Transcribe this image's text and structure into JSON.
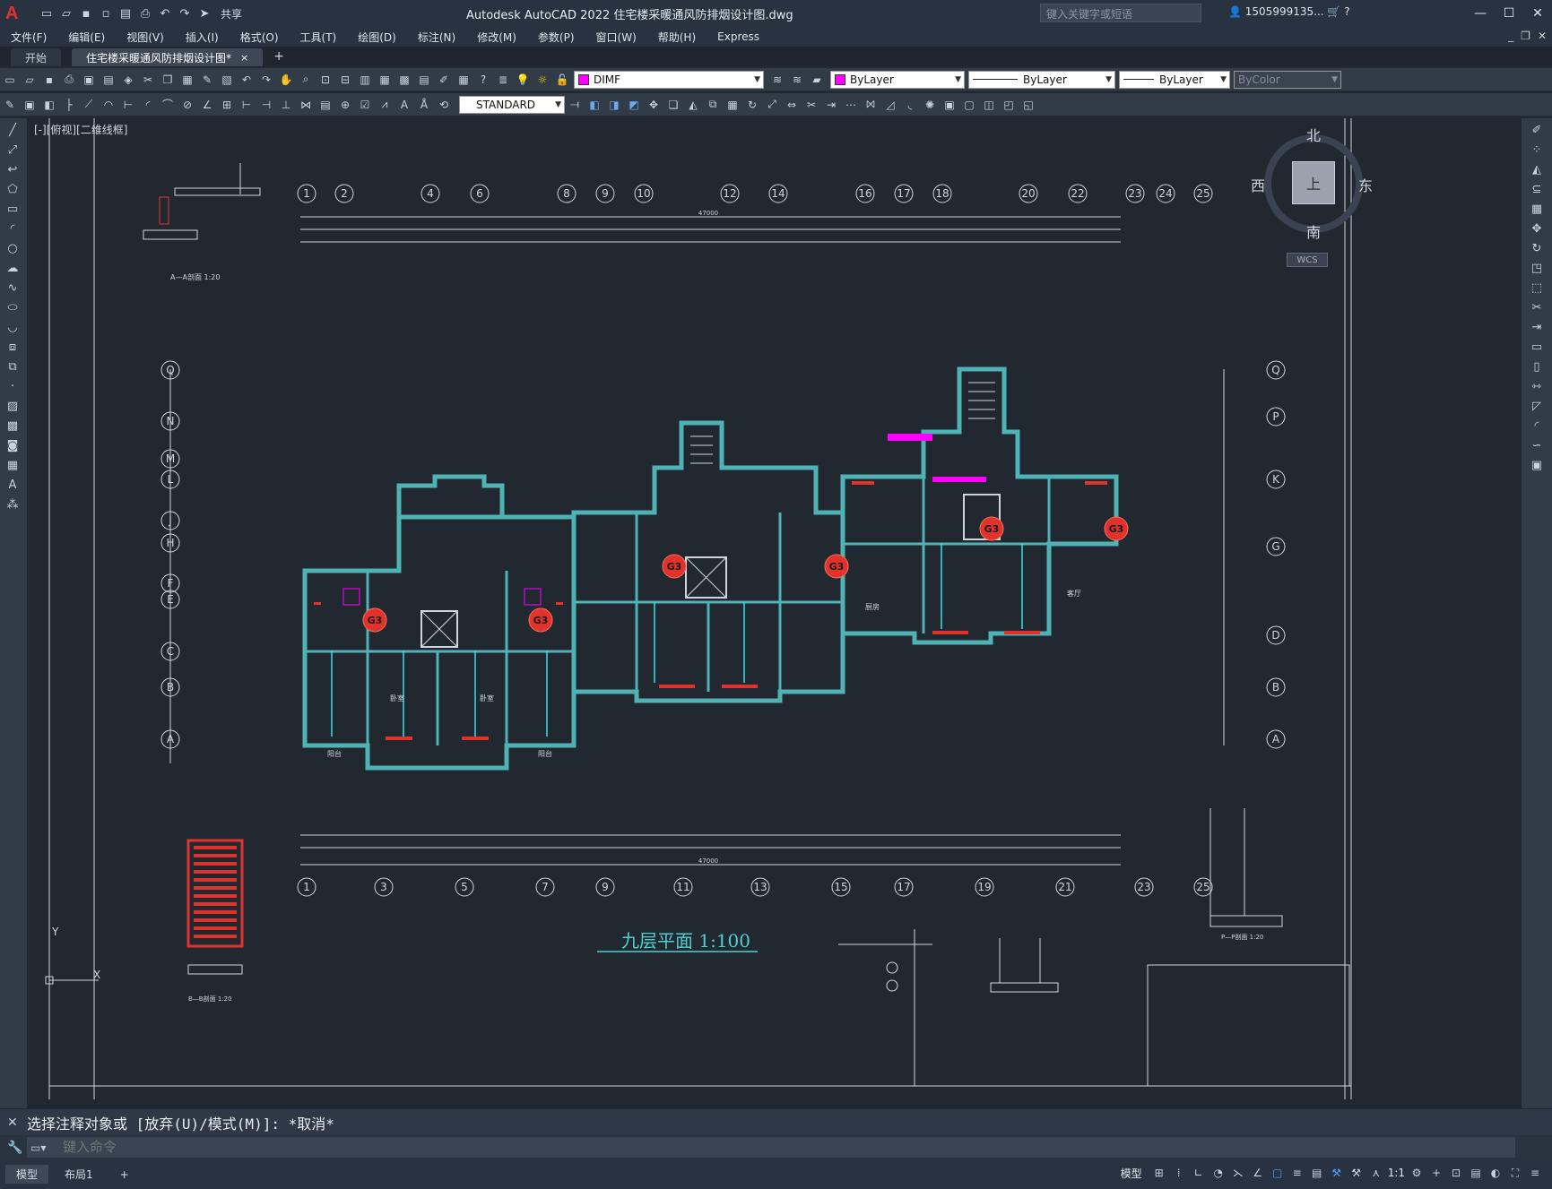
{
  "app": {
    "title": "Autodesk AutoCAD 2022    住宅楼采暖通风防排烟设计图.dwg",
    "share_label": "共享",
    "search_placeholder": "键入关键字或短语",
    "user_name": "1505999135..."
  },
  "menu": [
    "文件(F)",
    "编辑(E)",
    "视图(V)",
    "插入(I)",
    "格式(O)",
    "工具(T)",
    "绘图(D)",
    "标注(N)",
    "修改(M)",
    "参数(P)",
    "窗口(W)",
    "帮助(H)",
    "Express"
  ],
  "tabs": {
    "start_label": "开始",
    "doc_label": "住宅楼采暖通风防排烟设计图*",
    "close_icon": "×",
    "new_tab_icon": "+"
  },
  "toolbar": {
    "layer_name": "DIMF",
    "color_value": "ByLayer",
    "linetype_value": "ByLayer",
    "lineweight_value": "ByLayer",
    "plotstyle_value": "ByColor",
    "textstyle_value": "STANDARD"
  },
  "viewport": {
    "view_label": "[-][俯视][二维线框]",
    "compass": {
      "north": "北",
      "south": "南",
      "east": "东",
      "west": "西",
      "top": "上",
      "wcs": "WCS"
    },
    "plan_title": "九层平面 1:100",
    "top_axes": [
      "1",
      "2",
      "4",
      "6",
      "8",
      "9",
      "10",
      "12",
      "14",
      "16",
      "17",
      "18",
      "20",
      "22",
      "23",
      "24",
      "25"
    ],
    "bottom_axes": [
      "1",
      "3",
      "5",
      "7",
      "9",
      "11",
      "13",
      "15",
      "17",
      "19",
      "21",
      "23",
      "25"
    ],
    "left_axes": [
      "Q",
      "N",
      "M",
      "L",
      "J",
      "H",
      "F",
      "E",
      "C",
      "B",
      "A"
    ],
    "right_axes": [
      "Q",
      "P",
      "K",
      "G",
      "D",
      "B",
      "A"
    ],
    "overall_dim": "47000",
    "section_a": "A—A剖面 1:20",
    "section_p": "P—P剖面 1:20",
    "section_b": "B—B剖面 1:20",
    "room_labels": [
      "卧室",
      "卧室",
      "阳台",
      "阳台",
      "厨房",
      "客厅"
    ],
    "unit_marker": "G3",
    "ucs_y": "Y",
    "ucs_x": "X"
  },
  "command": {
    "history": "选择注释对象或 [放弃(U)/模式(M)]: *取消*",
    "input_placeholder": "键入命令"
  },
  "status": {
    "tab_model": "模型",
    "tab_layout": "布局1",
    "model_label": "模型",
    "scale_label": "1:1"
  },
  "colors": {
    "accent": "#ff00ff",
    "wall": "#4fb3b6",
    "marker": "#e0332c",
    "title_text": "#4fd0d0"
  }
}
